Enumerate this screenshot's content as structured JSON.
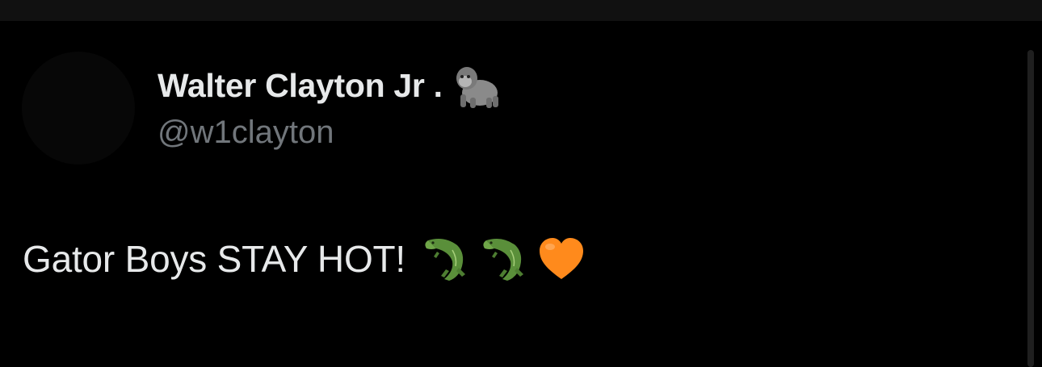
{
  "post": {
    "author": {
      "display_name": "Walter Clayton Jr .",
      "name_emoji": "gorilla-emoji",
      "handle": "@w1clayton"
    },
    "text": "Gator Boys STAY HOT!",
    "text_emojis": [
      "crocodile-emoji",
      "crocodile-emoji",
      "orange-heart-emoji"
    ]
  },
  "colors": {
    "background": "#000000",
    "name": "#e7e9ea",
    "handle": "#71767b",
    "heart": "#ff8a1c",
    "crocodile": "#5a8f3a"
  }
}
